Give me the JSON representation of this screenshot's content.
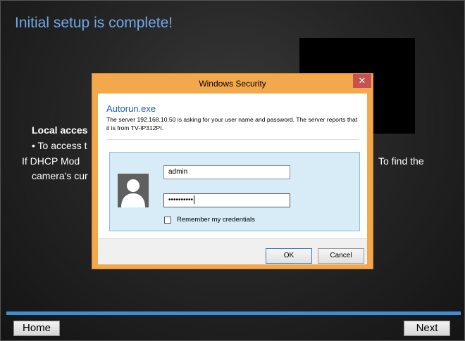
{
  "installer": {
    "title": "Initial setup is complete!",
    "local_access": {
      "heading": "Local acces",
      "line1": "• To access t",
      "line2": "If DHCP Mod",
      "line3": "camera's cur",
      "right_text": "To find the"
    },
    "home_label": "Home",
    "next_label": "Next"
  },
  "dialog": {
    "title": "Windows Security",
    "app_name": "Autorun.exe",
    "message": "The server 192.168.10.50 is asking for your user name and password. The server reports that it is from TV-IP312PI.",
    "username_value": "admin",
    "password_mask": "••••••••••",
    "remember_label": "Remember my credentials",
    "remember_checked": false,
    "ok_label": "OK",
    "cancel_label": "Cancel"
  },
  "icons": {
    "close": "close-icon",
    "avatar": "user-avatar-icon"
  },
  "colors": {
    "title_blue": "#6fa8e8",
    "dialog_accent": "#f4a84c",
    "close_red": "#c75050",
    "panel_blue": "#d7ecf7",
    "footer_band": "#3a8fd6"
  }
}
